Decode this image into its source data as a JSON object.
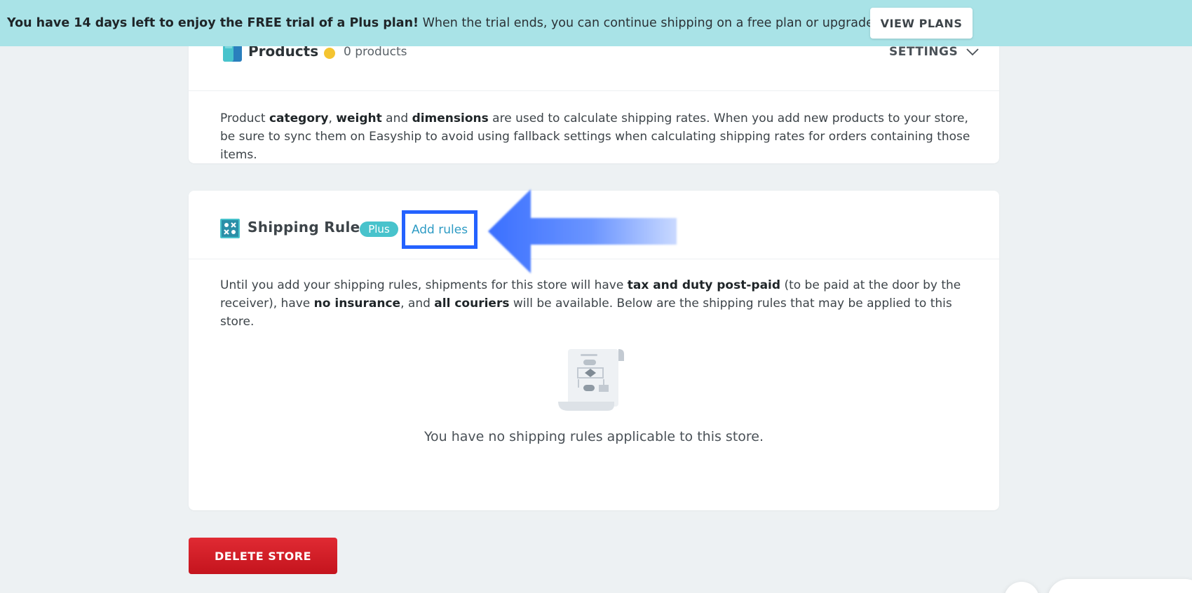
{
  "banner": {
    "bold_text": "You have 14 days left to enjoy the FREE trial of a Plus plan!",
    "text": " When the trial ends, you can continue shipping on a free plan or upgrade to a paid plan.",
    "button_label": "VIEW PLANS"
  },
  "products": {
    "title": "Products",
    "count_label": "0 products",
    "status_color": "#f4c430",
    "settings_label": "SETTINGS",
    "description": {
      "t1": "Product ",
      "b1": "category",
      "t2": ", ",
      "b2": "weight",
      "t3": " and ",
      "b3": "dimensions",
      "t4": " are used to calculate shipping rates. When you add new products to your store, be sure to sync them on Easyship to avoid using fallback settings when calculating shipping rates for orders containing those items."
    }
  },
  "shipping_rules": {
    "title": "Shipping Rules",
    "badge": "Plus",
    "add_label": "Add rules",
    "description": {
      "t1": "Until you add your shipping rules, shipments for this store will have ",
      "b1": "tax and duty post-paid",
      "t2": " (to be paid at the door by the receiver), have ",
      "b2": "no insurance",
      "t3": ", and ",
      "b3": "all couriers",
      "t4": " will be available. Below are the shipping rules that may be applied to this store."
    },
    "empty_text": "You have no shipping rules applicable to this store."
  },
  "actions": {
    "delete_label": "DELETE STORE"
  },
  "colors": {
    "banner_bg": "#a9e3e7",
    "accent": "#48c3cc",
    "highlight": "#2462ff",
    "danger": "#d41f28"
  }
}
